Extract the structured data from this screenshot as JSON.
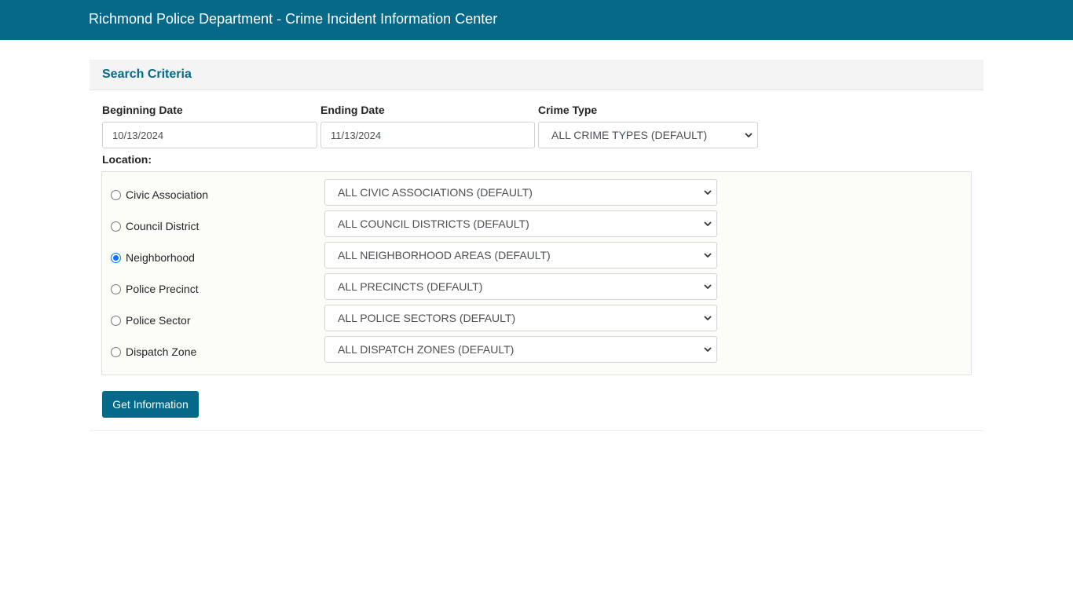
{
  "header": {
    "title": "Richmond Police Department - Crime Incident Information Center"
  },
  "search": {
    "title": "Search Criteria",
    "beginning_date": {
      "label": "Beginning Date",
      "value": "10/13/2024"
    },
    "ending_date": {
      "label": "Ending Date",
      "value": "11/13/2024"
    },
    "crime_type": {
      "label": "Crime Type",
      "value": "ALL CRIME TYPES (DEFAULT)"
    },
    "location": {
      "label": "Location:",
      "selected": "Neighborhood",
      "rows": [
        {
          "label": "Civic Association",
          "select_value": "ALL CIVIC ASSOCIATIONS (DEFAULT)",
          "checked": false
        },
        {
          "label": "Council District",
          "select_value": "ALL COUNCIL DISTRICTS (DEFAULT)",
          "checked": false
        },
        {
          "label": "Neighborhood",
          "select_value": "ALL NEIGHBORHOOD AREAS (DEFAULT)",
          "checked": true
        },
        {
          "label": "Police Precinct",
          "select_value": "ALL PRECINCTS (DEFAULT)",
          "checked": false
        },
        {
          "label": "Police Sector",
          "select_value": "ALL POLICE SECTORS (DEFAULT)",
          "checked": false
        },
        {
          "label": "Dispatch Zone",
          "select_value": "ALL DISPATCH ZONES (DEFAULT)",
          "checked": false
        }
      ]
    },
    "submit_label": "Get Information"
  },
  "colors": {
    "brand": "#05698a",
    "radio_checked": "#0075ff"
  }
}
